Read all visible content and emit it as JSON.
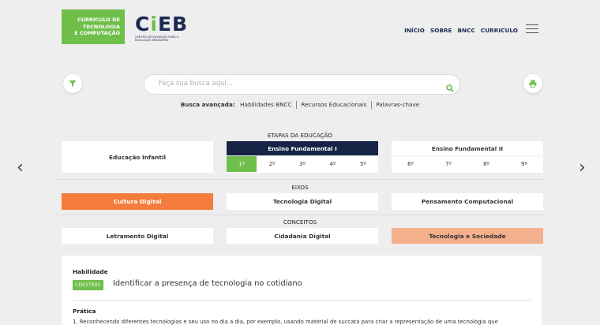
{
  "brand": {
    "lines": [
      "CURRÍCULO DE",
      "TECNOLOGIA",
      "E COMPUTAÇÃO"
    ],
    "logo_text": "CIEB",
    "logo_subtitle": "CENTRO DE INOVAÇÃO PARA A EDUCAÇÃO BRASILEIRA"
  },
  "nav": [
    "INÍCIO",
    "SOBRE",
    "BNCC",
    "CURRICULO"
  ],
  "search": {
    "placeholder": "Faça sua busca aqui...",
    "advanced_label": "Busca avançada:",
    "advanced_links": [
      "Habilidades BNCC",
      "Recursos Educacionais",
      "Palavras-chave"
    ]
  },
  "etapas": {
    "title": "ETAPAS DA EDUCAÇÃO",
    "infantil": "Educação Infantil",
    "fund1": {
      "label": "Ensino Fundamental I",
      "years": [
        "1º",
        "2º",
        "3º",
        "4º",
        "5º"
      ],
      "active_year": "1º"
    },
    "fund2": {
      "label": "Ensino Fundamental II",
      "years": [
        "6º",
        "7º",
        "8º",
        "9º"
      ]
    }
  },
  "eixos": {
    "title": "EIXOS",
    "items": [
      "Cultura Digital",
      "Tecnologia Digital",
      "Pensamento Computacional"
    ],
    "active": "Cultura Digital"
  },
  "conceitos": {
    "title": "CONCEITOS",
    "items": [
      "Letramento Digital",
      "Cidadania Digital",
      "Tecnologia e Sociedade"
    ],
    "active": "Tecnologia e Sociedade"
  },
  "content": {
    "habilidade_label": "Habilidade",
    "code": "CD01TS01",
    "habilidade_text": "Identificar a presença de tecnologia no cotidiano",
    "pratica_label": "Prática",
    "pratica_text": "1. Reconhecendo diferentes tecnologias e seu uso no dia a dia, por exemplo, usando material de succata para criar a representação de uma tecnologia que"
  },
  "colors": {
    "green": "#6fbf4a",
    "navy": "#152445",
    "orange": "#f47c3c",
    "salmon": "#f4b08c"
  },
  "icons": [
    "filter-icon",
    "search-icon",
    "print-icon",
    "chevron-left-icon",
    "chevron-right-icon",
    "hamburger-icon"
  ]
}
